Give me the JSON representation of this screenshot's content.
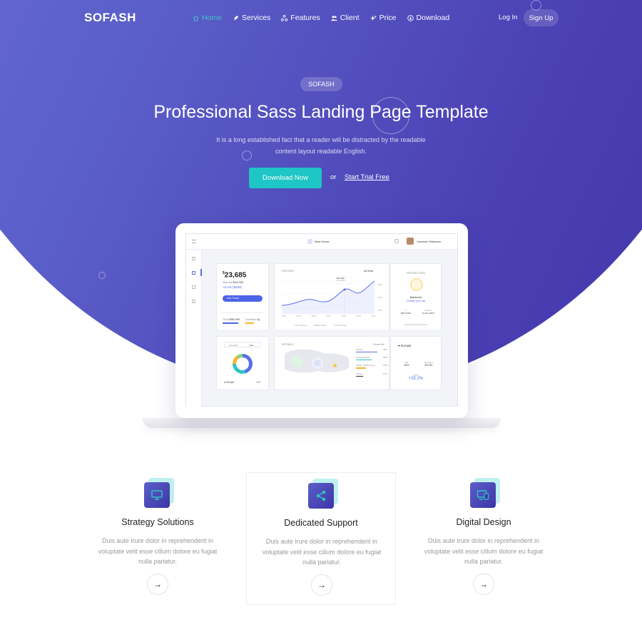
{
  "brand": {
    "logo": "SOFASH",
    "accent": "#42c6c9",
    "primary": "#4a3fb3"
  },
  "nav": {
    "items": [
      {
        "label": "Home",
        "icon": "home-icon"
      },
      {
        "label": "Services",
        "icon": "rocket-icon"
      },
      {
        "label": "Features",
        "icon": "share-icon"
      },
      {
        "label": "Client",
        "icon": "users-icon"
      },
      {
        "label": "Price",
        "icon": "sparkle-icon"
      },
      {
        "label": "Download",
        "icon": "download-icon"
      }
    ],
    "login": "Log In",
    "signup": "Sign Up"
  },
  "hero": {
    "badge": "SOFASH",
    "title": "Professional Sass Landing Page Template",
    "subtitle": "It is a long established fact that a reader will be distracted by the readable content layout readable English.",
    "download_label": "Download Now",
    "or_label": "or",
    "trial_label": "Start Trial Free"
  },
  "dashboard": {
    "house": "New House",
    "user": "Cameron Swanson",
    "balance": "23,685",
    "balance_currency": "$",
    "deposit_label": "Deposit",
    "deposit_value": "$16,000",
    "change": "+5.2% ($456)",
    "add_funds": "Add Funds",
    "goal_label": "Goal",
    "goal_value": "$35,000",
    "duration_label": "Duration",
    "duration_value": "4y",
    "history_label": "HISTORY",
    "history_range": "All time",
    "history_y": [
      "$20k",
      "$15k",
      "$10k"
    ],
    "history_x": [
      "2011",
      "2012",
      "2013",
      "2014",
      "2015",
      "2016",
      "2017"
    ],
    "history_tooltip_value": "$16,346",
    "history_tooltip_date": "June 2016",
    "legend": [
      "Your balance",
      "Market value",
      "Your deposits"
    ],
    "projection_label": "PROJECTION",
    "projection_status": "Balanced",
    "projection_link": "Change your risk",
    "projection_left_label": "Yr",
    "projection_left_value": "$347,5410",
    "projection_right_label": "Created",
    "projection_right_value": "31 Dec 2015",
    "download_report": "Download overall report",
    "allocation_tab": "Allocation",
    "geo_tab": "Geo",
    "region": "Europe",
    "region_pct": "45%",
    "details_label": "DETAILS",
    "show_all": "Show All",
    "regions": [
      {
        "name": "Europe",
        "pct": "45%"
      },
      {
        "name": "North America",
        "pct": "30%"
      },
      {
        "name": "Japan, South Korea",
        "pct": "15%"
      },
      {
        "name": "Others",
        "pct": "10%"
      }
    ],
    "region_detail_title": "Europe",
    "share_label": "Bts",
    "share_value": "45%",
    "allocation_label": "Allocation",
    "allocation_value": "$72.8K",
    "profit_label": "Profit",
    "profit_value": "+35.2%"
  },
  "features": [
    {
      "title": "Strategy Solutions",
      "desc": "Duis aute irure dolor in reprehenderit in voluptate velit esse cillum dolore eu fugiat nulla pariatur.",
      "icon": "monitor-icon"
    },
    {
      "title": "Dedicated Support",
      "desc": "Duis aute irure dolor in reprehenderit in voluptate velit esse cillum dolore eu fugiat nulla pariatur.",
      "icon": "share-icon"
    },
    {
      "title": "Digital Design",
      "desc": "Duis aute irure dolor in reprehenderit in voluptate velit esse cillum dolore eu fugiat nulla pariatur.",
      "icon": "devices-icon"
    }
  ]
}
